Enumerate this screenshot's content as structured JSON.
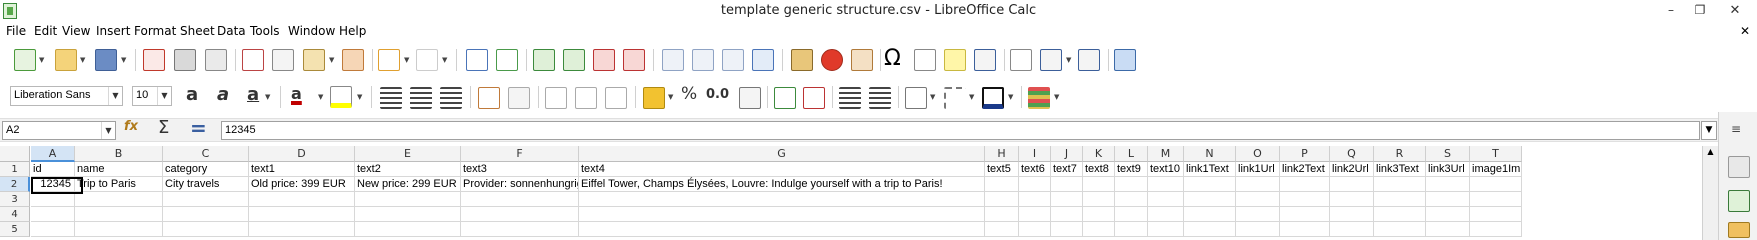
{
  "window": {
    "title": "template generic structure.csv - LibreOffice Calc",
    "minimize": "–",
    "restore": "❐",
    "close": "✕"
  },
  "menu": [
    "File",
    "Edit",
    "View",
    "Insert",
    "Format",
    "Sheet",
    "Data",
    "Tools",
    "Window",
    "Help"
  ],
  "menu_close": "✕",
  "formatting": {
    "font_name": "Liberation Sans",
    "font_size": "10",
    "percent": "%",
    "number_format": "0.0"
  },
  "formula_bar": {
    "name_box": "A2",
    "content": "12345"
  },
  "columns": [
    "A",
    "B",
    "C",
    "D",
    "E",
    "F",
    "G",
    "H",
    "I",
    "J",
    "K",
    "L",
    "M",
    "N",
    "O",
    "P",
    "Q",
    "R",
    "S",
    "T"
  ],
  "rows": [
    "1",
    "2",
    "3",
    "4",
    "5"
  ],
  "cells": {
    "row1": [
      "id",
      "name",
      "category",
      "text1",
      "text2",
      "text3",
      "text4",
      "text5",
      "text6",
      "text7",
      "text8",
      "text9",
      "text10",
      "link1Text",
      "link1Url",
      "link2Text",
      "link2Url",
      "link3Text",
      "link3Url",
      "image1Im"
    ],
    "row2": [
      "12345",
      "Trip to Paris",
      "City travels",
      "Old price: 399 EUR",
      "New price: 299 EUR",
      "Provider: sonnenhungrig",
      "Eiffel Tower, Champs Élysées, Louvre: Indulge yourself with a trip to Paris!"
    ]
  },
  "colors": {
    "selection_header": "#4a90d9",
    "selected_header_bg": "#d4e4f5",
    "toolbar_bg": "#ffffff",
    "ui_gray": "#f2f2f2"
  },
  "icons": {
    "function_wizard": "fx",
    "sum": "Σ",
    "formula": "="
  }
}
